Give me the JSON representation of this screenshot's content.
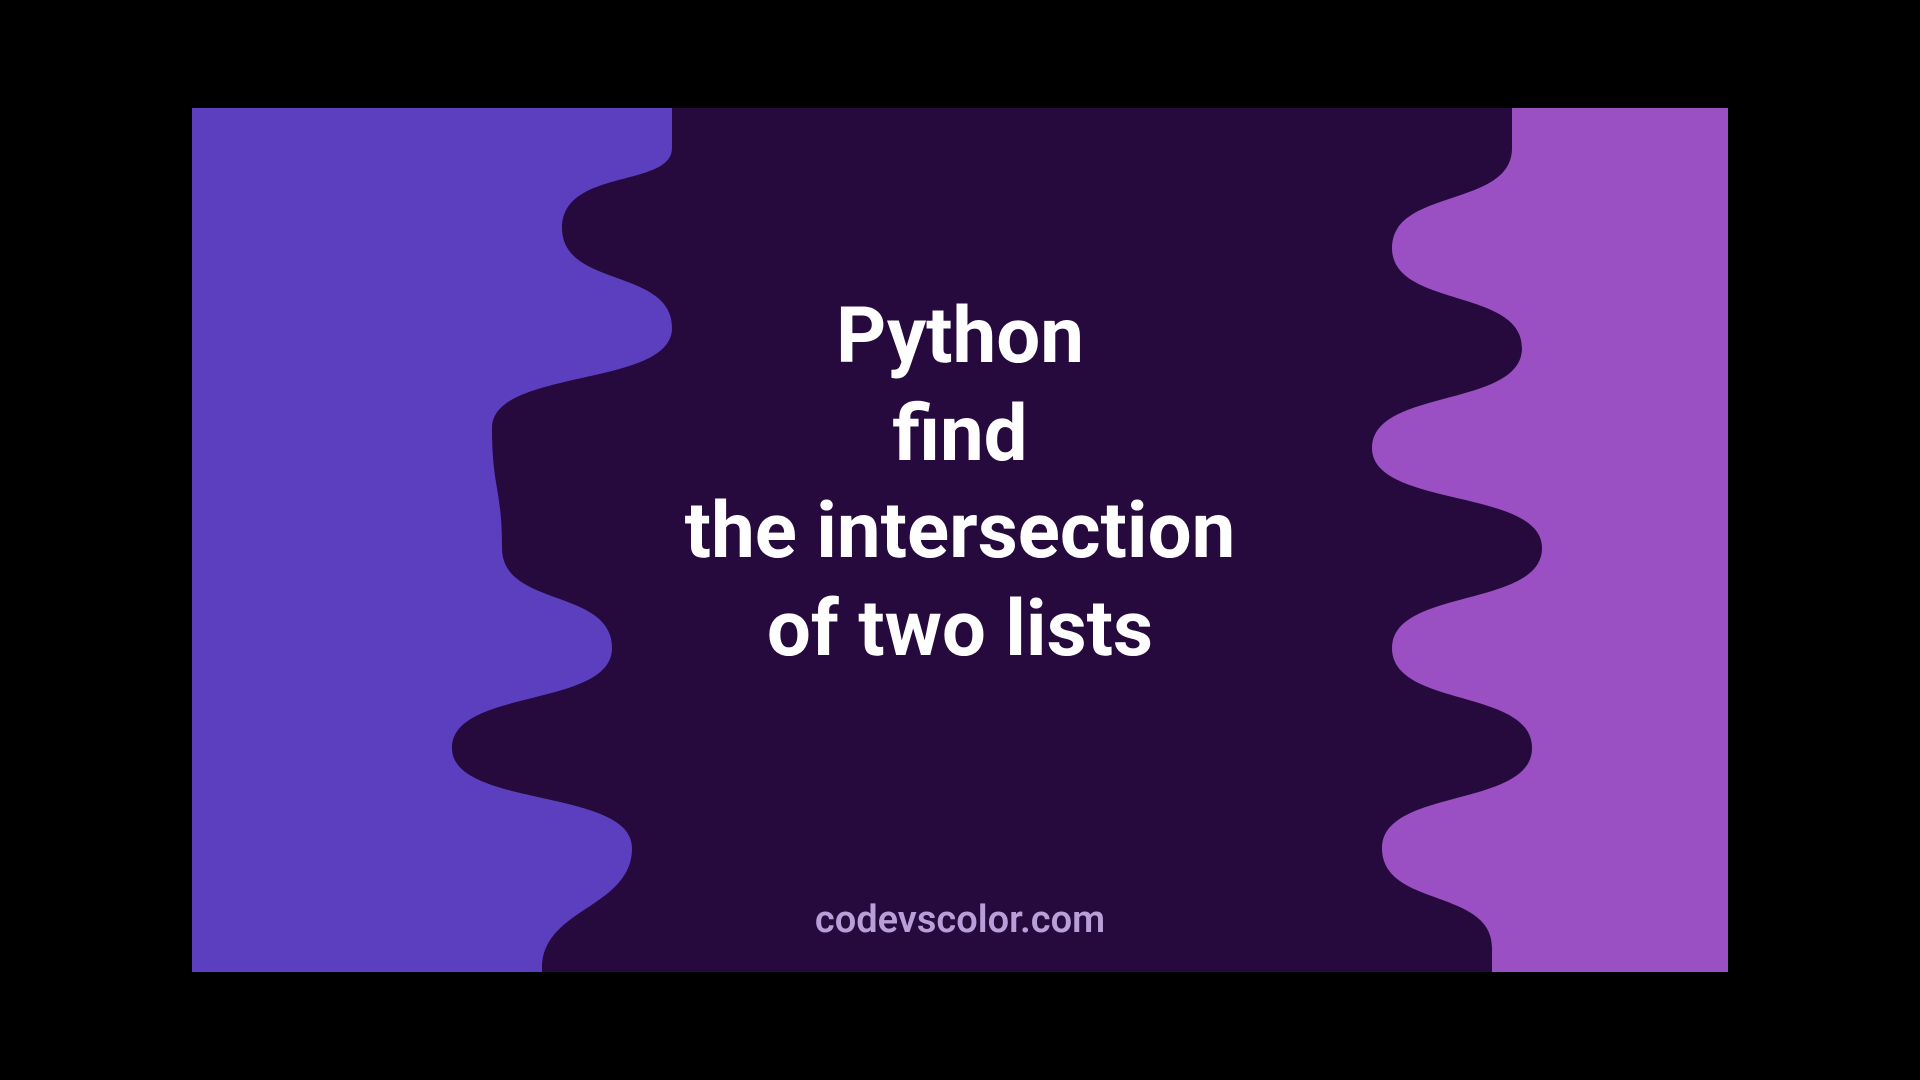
{
  "colors": {
    "left_bg": "#5c3fbf",
    "right_bg": "#9a50c3",
    "blob": "#260a3e",
    "title": "#ffffff",
    "watermark": "#b89fd8"
  },
  "title_lines": [
    "Python",
    "find",
    "the intersection",
    "of two lists"
  ],
  "watermark": "codevscolor.com"
}
